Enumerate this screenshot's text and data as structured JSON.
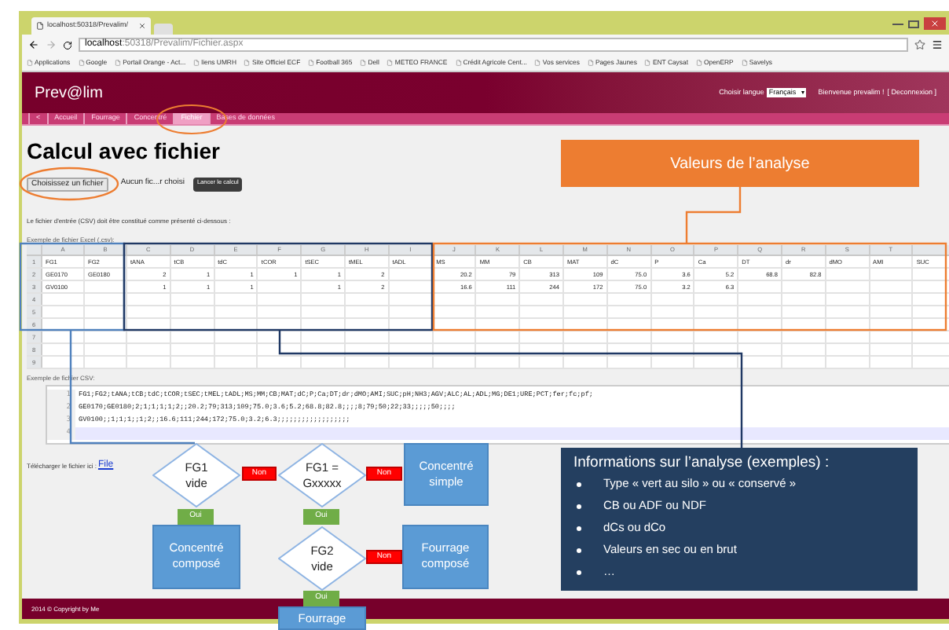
{
  "browser": {
    "tab_title": "localhost:50318/Prevalim/",
    "url_host": "localhost",
    "url_path": ":50318/Prevalim/Fichier.aspx",
    "bookmarks": [
      "Applications",
      "Google",
      "Portail Orange - Act...",
      "liens UMRH",
      "Site Officiel ECF",
      "Football 365",
      "Dell",
      "METEO FRANCE",
      "Crédit Agricole Cent...",
      "Vos services",
      "Pages Jaunes",
      "ENT Caysat",
      "OpenERP",
      "Savelys"
    ]
  },
  "header": {
    "logo": "Prev@lim",
    "language_label": "Choisir langue",
    "language": "Français",
    "welcome": "Bienvenue prevalim !",
    "logout": "[ Deconnexion ]"
  },
  "nav": [
    {
      "label": "<",
      "selected": false
    },
    {
      "label": "Accueil",
      "selected": false
    },
    {
      "label": "Fourrage",
      "selected": false
    },
    {
      "label": "Concentré",
      "selected": false
    },
    {
      "label": "Fichier",
      "selected": true
    },
    {
      "label": "Bases de données",
      "selected": false
    }
  ],
  "page": {
    "title": "Calcul avec fichier",
    "file_button": "Choisissez un fichier",
    "file_status": "Aucun fic...r choisi",
    "run_button": "Lancer le calcul",
    "intro": "Le fichier d'entrée (CSV) doit être constitué comme présenté ci-dessous :",
    "excel_label": "Exemple de fichier Excel (.csv):",
    "sheet": {
      "columns": [
        "A",
        "B",
        "C",
        "D",
        "E",
        "F",
        "G",
        "H",
        "I",
        "J",
        "K",
        "L",
        "M",
        "N",
        "O",
        "P",
        "Q",
        "R",
        "S",
        "T"
      ],
      "rows": [
        {
          "number": "1",
          "cells": [
            "FG1",
            "FG2",
            "tANA",
            "tCB",
            "tdC",
            "tCOR",
            "tSEC",
            "tMEL",
            "tADL",
            "MS",
            "MM",
            "CB",
            "MAT",
            "dC",
            "P",
            "Ca",
            "DT",
            "dr",
            "dMO",
            "AMI",
            "SUC"
          ]
        },
        {
          "number": "2",
          "cells": [
            "GE0170",
            "GE0180",
            "2",
            "1",
            "1",
            "1",
            "1",
            "2",
            null,
            "20.2",
            "79",
            "313",
            "109",
            "75.0",
            "3.6",
            "5.2",
            "68.8",
            "82.8",
            null,
            null,
            null
          ]
        },
        {
          "number": "3",
          "cells": [
            "GV0100",
            null,
            "1",
            "1",
            "1",
            null,
            "1",
            "2",
            null,
            "16.6",
            "111",
            "244",
            "172",
            "75.0",
            "3.2",
            "6.3",
            null,
            null,
            null,
            null,
            null
          ]
        },
        {
          "number": "4",
          "cells": []
        },
        {
          "number": "5",
          "cells": []
        },
        {
          "number": "6",
          "cells": []
        },
        {
          "number": "7",
          "cells": []
        },
        {
          "number": "8",
          "cells": []
        },
        {
          "number": "9",
          "cells": []
        }
      ]
    },
    "csv_label": "Exemple de fichier CSV:",
    "csv_lines": [
      {
        "number": "1",
        "text": "FG1;FG2;tANA;tCB;tdC;tCOR;tSEC;tMEL;tADL;MS;MM;CB;MAT;dC;P;Ca;DT;dr;dMO;AMI;SUC;pH;NH3;AGV;ALC;AL;ADL;MG;DE1;URE;PCT;fer;fc;pf;",
        "current": false
      },
      {
        "number": "2",
        "text": "GE0170;GE0180;2;1;1;1;1;2;;20.2;79;313;109;75.0;3.6;5.2;68.8;82.8;;;;8;79;50;22;33;;;;;50;;;;",
        "current": false
      },
      {
        "number": "3",
        "text": "GV0100;;1;1;1;;1;2;;16.6;111;244;172;75.0;3.2;6.3;;;;;;;;;;;;;;;;;;",
        "current": false
      },
      {
        "number": "4",
        "current": true
      }
    ],
    "download_label": "Télécharger le fichier ici :",
    "download_link": "File"
  },
  "footer": "2014 © Copyright by Me",
  "annotations": {
    "values_callout": "Valeurs de l’analyse",
    "info_box": {
      "title": "Informations sur l’analyse (exemples) :",
      "bullets": [
        "Type « vert au silo » ou « conservé »",
        "CB ou ADF ou NDF",
        "dCs ou dCo",
        "Valeurs en sec ou en brut",
        "…"
      ]
    },
    "flowchart": [
      {
        "kind": "decision",
        "lines": [
          "FG1",
          "vide"
        ]
      },
      {
        "kind": "no",
        "lines": [
          "Non"
        ]
      },
      {
        "kind": "decision",
        "lines": [
          "FG1 =",
          "Gxxxxx"
        ]
      },
      {
        "kind": "no",
        "lines": [
          "Non"
        ]
      },
      {
        "kind": "process",
        "lines": [
          "Concentré",
          "simple"
        ]
      },
      {
        "kind": "yes",
        "lines": [
          "Oui"
        ]
      },
      {
        "kind": "process",
        "lines": [
          "Concentré",
          "composé"
        ]
      },
      {
        "kind": "yes",
        "lines": [
          "Oui"
        ]
      },
      {
        "kind": "decision",
        "lines": [
          "FG2",
          "vide"
        ]
      },
      {
        "kind": "no",
        "lines": [
          "Non"
        ]
      },
      {
        "kind": "process",
        "lines": [
          "Fourrage",
          "composé"
        ]
      },
      {
        "kind": "yes",
        "lines": [
          "Oui"
        ]
      },
      {
        "kind": "process",
        "lines": [
          "Fourrage"
        ]
      }
    ]
  }
}
